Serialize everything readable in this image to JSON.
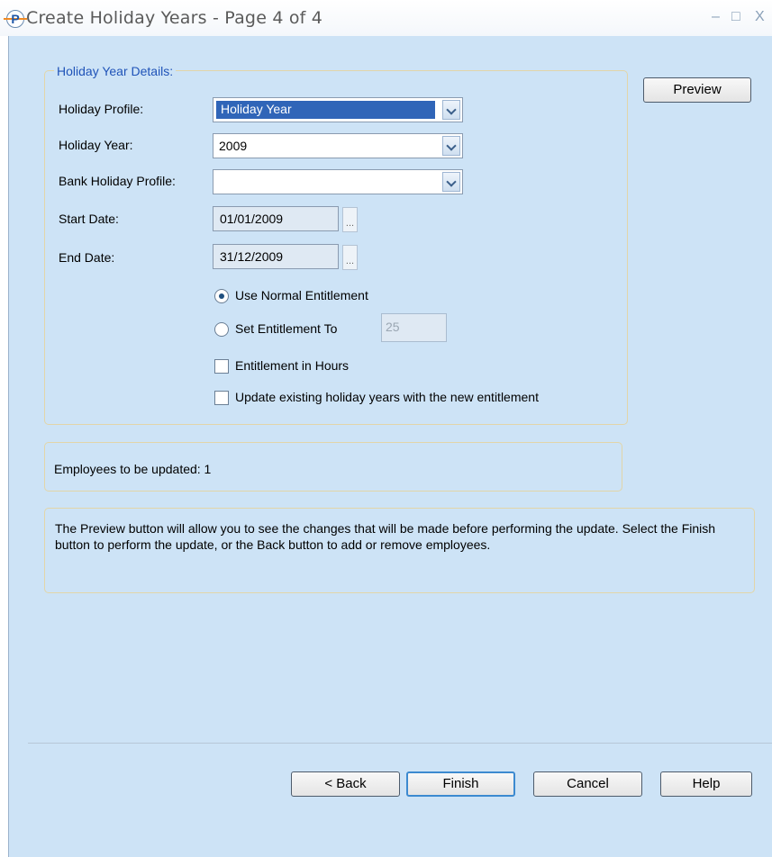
{
  "window": {
    "title": "Create Holiday Years - Page 4 of 4",
    "app_icon_letter": "P",
    "minimize_glyph": "–",
    "maximize_glyph": "□",
    "close_glyph": "X"
  },
  "details": {
    "legend": "Holiday Year Details:",
    "holiday_profile": {
      "label": "Holiday Profile:",
      "value": "Holiday Year"
    },
    "holiday_year": {
      "label": "Holiday Year:",
      "value": "2009"
    },
    "bank_holiday_profile": {
      "label": "Bank Holiday Profile:",
      "value": ""
    },
    "start_date": {
      "label": "Start Date:",
      "value": "01/01/2009"
    },
    "end_date": {
      "label": "End Date:",
      "value": "31/12/2009"
    },
    "ellipsis": "...",
    "entitlement": {
      "use_normal_label": "Use Normal Entitlement",
      "use_normal_selected": true,
      "set_to_label": "Set Entitlement To",
      "set_to_value": "25",
      "in_hours_label": "Entitlement in Hours",
      "in_hours_checked": false,
      "update_existing_label": "Update existing holiday years with the new entitlement",
      "update_existing_checked": false
    }
  },
  "preview_button": "Preview",
  "employees_info": "Employees to be updated: 1",
  "help_text": "The Preview button will allow you to see the changes that will be made before performing the update. Select the Finish button to perform the update, or the Back button to add or remove employees.",
  "footer": {
    "back": "< Back",
    "finish": "Finish",
    "cancel": "Cancel",
    "help": "Help"
  },
  "colors": {
    "background": "#cde3f6",
    "legend": "#1f53b8",
    "selection": "#3065b8",
    "default_button_border": "#3c8ad0"
  }
}
